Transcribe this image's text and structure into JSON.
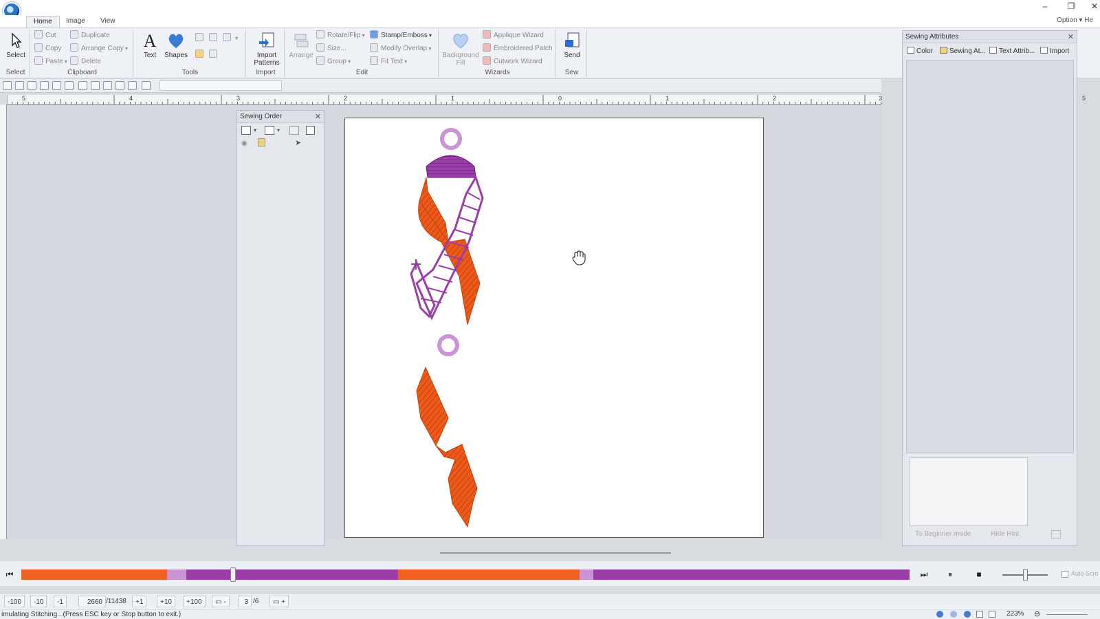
{
  "tabs": [
    "Home",
    "Image",
    "View"
  ],
  "right_menu": "Option ▾ He",
  "ribbon": {
    "select": {
      "label": "Select",
      "group": "Select"
    },
    "clipboard": {
      "group": "Clipboard",
      "cut": "Cut",
      "copy": "Copy",
      "paste": "Paste",
      "duplicate": "Duplicate",
      "arrange_copy": "Arrange Copy",
      "delete": "Delete"
    },
    "tools": {
      "group": "Tools",
      "text": "Text",
      "shapes": "Shapes"
    },
    "import": {
      "group": "Import",
      "import_patterns": "Import Patterns"
    },
    "edit": {
      "group": "Edit",
      "arrange": "Arrange",
      "rotate_flip": "Rotate/Flip",
      "size": "Size...",
      "group_btn": "Group",
      "stamp_emboss": "Stamp/Emboss",
      "modify_overlap": "Modify Overlap",
      "fit_text": "Fit Text"
    },
    "wizards": {
      "group": "Wizards",
      "background_fill": "Background Fill",
      "applique_wizard": "Applique Wizard",
      "embroidered_patch": "Embroidered Patch",
      "cutwork_wizard": "Cutwork Wizard"
    },
    "sew": {
      "group": "Sew",
      "send": "Send"
    }
  },
  "ruler_labels": [
    "5",
    "4",
    "3",
    "2",
    "1",
    "0",
    "1",
    "2",
    "3",
    "5"
  ],
  "sewing_order": {
    "title": "Sewing Order"
  },
  "sewing_attributes": {
    "title": "Sewing Attributes",
    "tabs": [
      "Color",
      "Sewing At...",
      "Text Attrib...",
      "Import"
    ],
    "beginner_mode": "To Beginner mode",
    "hide_hint": "Hide Hint"
  },
  "steps": {
    "minus100": "-100",
    "minus10": "-10",
    "minus1": "-1",
    "current_stitch": "2660",
    "total_stitches": "/11438",
    "plus1": "+1",
    "plus10": "+10",
    "plus100": "+100",
    "color_current": "3",
    "color_total": "/6"
  },
  "zoom": "223%",
  "auto_scroll": "Auto Scro",
  "status": "imulating Stitching...(Press ESC key or Stop button to exit.)",
  "colors": {
    "orange": "#f06022",
    "purple": "#9a3fa8",
    "light_purple": "#c993d6"
  },
  "timeline": {
    "progress": 0.235,
    "segments": [
      "orange",
      "light_purple",
      "purple",
      "orange",
      "light_purple",
      "purple"
    ]
  }
}
